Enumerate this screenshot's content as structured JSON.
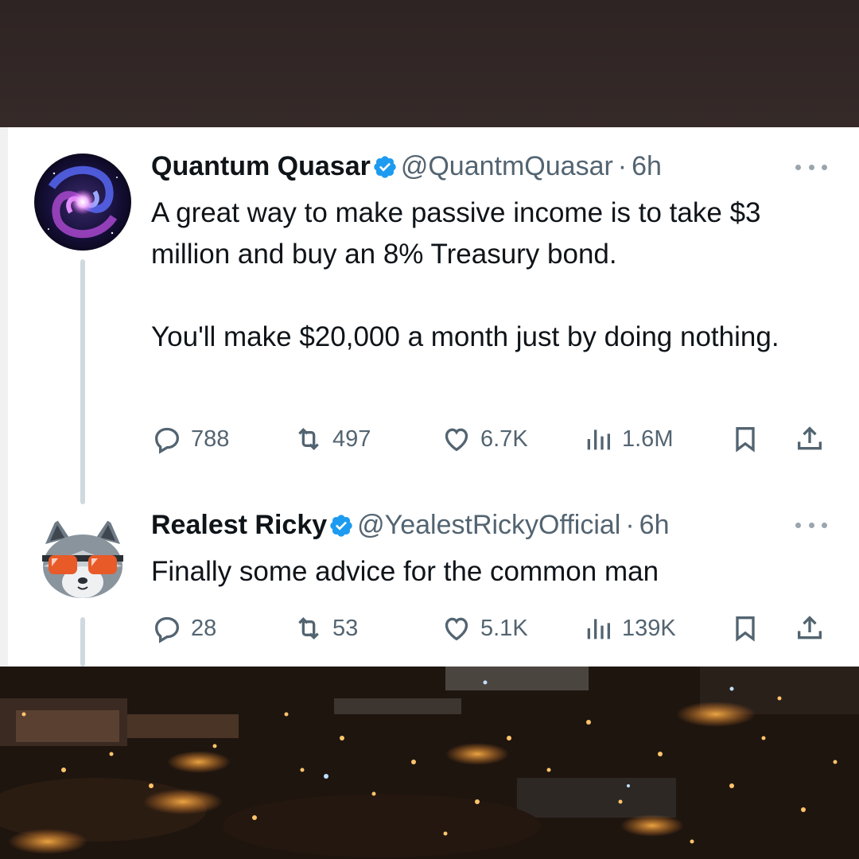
{
  "tweets": [
    {
      "name": "Quantum Quasar",
      "handle": "@QuantmQuasar",
      "dot": "·",
      "time": "6h",
      "text": "A great way to make passive income is to take $3 million and buy an 8% Treasury bond.\n\nYou'll make $20,000 a month just by doing nothing.",
      "replies": "788",
      "reposts": "497",
      "likes": "6.7K",
      "views": "1.6M",
      "avatar_icon": "galaxy-avatar"
    },
    {
      "name": "Realest Ricky",
      "handle": "@YealestRickyOfficial",
      "dot": "·",
      "time": "6h",
      "text": "Finally some advice for the common man",
      "replies": "28",
      "reposts": "53",
      "likes": "5.1K",
      "views": "139K",
      "avatar_icon": "raccoon-sunglasses-avatar"
    }
  ],
  "colors": {
    "verified": "#1d9bf0",
    "text": "#0f1419",
    "muted": "#536471"
  }
}
